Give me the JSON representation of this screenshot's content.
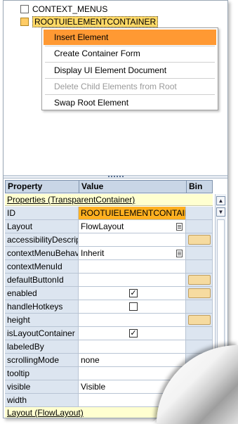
{
  "tree": {
    "nodes": [
      {
        "label": "CONTEXT_MENUS",
        "selected": false
      },
      {
        "label": "ROOTUIELEMENTCONTAINER",
        "selected": true
      }
    ]
  },
  "context_menu": {
    "items": [
      {
        "label": "Insert Element",
        "state": "highlighted"
      },
      {
        "label": "Create Container Form",
        "state": "normal"
      },
      {
        "label": "Display UI Element Document",
        "state": "normal"
      },
      {
        "label": "Delete Child Elements from Root",
        "state": "disabled"
      },
      {
        "label": "Swap Root Element",
        "state": "normal"
      }
    ]
  },
  "properties": {
    "headers": {
      "property": "Property",
      "value": "Value",
      "binding": "Bin"
    },
    "group_title": "Properties (TransparentContainer)",
    "footer_group": "Layout (FlowLayout)",
    "rows": [
      {
        "name": "ID",
        "value": "ROOTUIELEMENTCONTAINER",
        "value_highlight": true,
        "bind_button": false
      },
      {
        "name": "Layout",
        "value": "FlowLayout",
        "dropdown": true,
        "bind_button": false
      },
      {
        "name": "accessibilityDescription",
        "value": "",
        "bind_button": true
      },
      {
        "name": "contextMenuBehaviour",
        "value": "Inherit",
        "dropdown": true,
        "bind_button": false
      },
      {
        "name": "contextMenuId",
        "value": "",
        "bind_button": false
      },
      {
        "name": "defaultButtonId",
        "value": "",
        "bind_button": true
      },
      {
        "name": "enabled",
        "checkbox": true,
        "checked": true,
        "bind_button": true
      },
      {
        "name": "handleHotkeys",
        "checkbox": true,
        "checked": false,
        "bind_button": false
      },
      {
        "name": "height",
        "value": "",
        "bind_button": true
      },
      {
        "name": "isLayoutContainer",
        "checkbox": true,
        "checked": true,
        "bind_button": false
      },
      {
        "name": "labeledBy",
        "value": "",
        "bind_button": false
      },
      {
        "name": "scrollingMode",
        "value": "none",
        "bind_button": false
      },
      {
        "name": "tooltip",
        "value": "",
        "bind_button": false
      },
      {
        "name": "visible",
        "value": "Visible",
        "bind_button": false
      },
      {
        "name": "width",
        "value": "",
        "bind_button": false
      }
    ]
  },
  "icons": {
    "checkmark": "✓",
    "scroll_up": "▲",
    "scroll_down": "▼"
  },
  "colors": {
    "menu_highlight": "#ff9933",
    "selected_value": "#ffb020",
    "header_bg": "#c9d6e6",
    "group_bg": "#ffffd0",
    "bind_button": "#f6dba0"
  }
}
